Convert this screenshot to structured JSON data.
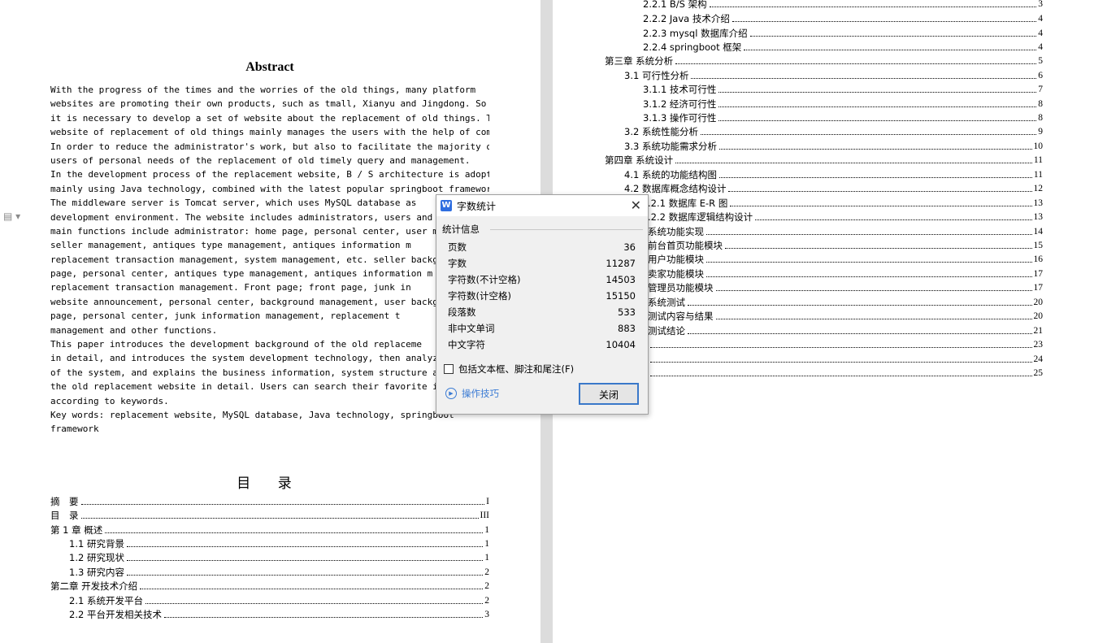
{
  "abstract": {
    "title": "Abstract",
    "lines": [
      "    With the progress of the times and the worries of the old things, many platform",
      "websites are promoting their own products, such as tmall, Xianyu and Jingdong. So",
      "it is necessary to develop a set of website about the replacement of old things. The",
      "website of replacement of old things mainly manages the users with the help of computer.",
      "In order to reduce the administrator's work, but also to facilitate the majority of",
      "users of personal needs of the replacement of old timely query and management.",
      "In the development process of the replacement website, B / S architecture is adopted,",
      "mainly using Java technology, combined with the latest popular springboot framework.",
      "The middleware server is Tomcat server, which uses MySQL database as",
      "development environment. The website includes administrators, users and se",
      "main functions include administrator: home page, personal center, user m",
      "seller management, antiques type management, antiques information m",
      "replacement transaction management, system management, etc. seller backgr",
      "page, personal center, antiques type management, antiques information m",
      "replacement transaction management. Front page; front page, junk in",
      "website announcement, personal center, background management, user backgro",
      "page, personal center, junk information management, replacement t",
      "management and other functions.",
      "    This paper introduces the development background of the old replaceme",
      "in detail, and introduces the system development technology, then analyzes",
      "of the system, and explains the business information, system structure a",
      "the old replacement website in detail. Users can search their favorite i",
      "according to keywords.",
      "    Key words: replacement website, MySQL database, Java technology, springboot",
      "framework"
    ]
  },
  "toc_left": {
    "title": "目 录",
    "items": [
      {
        "text": "摘　要",
        "page": "I"
      },
      {
        "text": "目　录",
        "page": "III"
      },
      {
        "text": "第 1 章  概述",
        "page": "1"
      },
      {
        "text": "1.1  研究背景",
        "page": "1"
      },
      {
        "text": "1.2  研究现状",
        "page": "1"
      },
      {
        "text": "1.3  研究内容",
        "page": "2"
      },
      {
        "text": "第二章  开发技术介绍",
        "page": "2"
      },
      {
        "text": "2.1    系统开发平台",
        "page": "2"
      },
      {
        "text": "2.2  平台开发相关技术",
        "page": "3"
      }
    ]
  },
  "toc_right": {
    "items": [
      {
        "text": "2.2.1    B/S 架构",
        "page": "3"
      },
      {
        "text": "2.2.2    Java 技术介绍",
        "page": "4"
      },
      {
        "text": "2.2.3    mysql 数据库介绍",
        "page": "4"
      },
      {
        "text": "2.2.4    springboot 框架",
        "page": "4"
      },
      {
        "text": "第三章  系统分析",
        "page": "5"
      },
      {
        "text": "3.1  可行性分析",
        "page": "6"
      },
      {
        "text": "3.1.1    技术可行性",
        "page": "7"
      },
      {
        "text": "3.1.2  经济可行性",
        "page": "8"
      },
      {
        "text": "3.1.3  操作可行性",
        "page": "8"
      },
      {
        "text": "3.2  系统性能分析",
        "page": "9"
      },
      {
        "text": "3.3  系统功能需求分析",
        "page": "10"
      },
      {
        "text": "第四章  系统设计",
        "page": "11"
      },
      {
        "text": "4.1  系统的功能结构图",
        "page": "11"
      },
      {
        "text": "4.2  数据库概念结构设计",
        "page": "12"
      },
      {
        "text": ".2.1    数据库 E-R 图",
        "page": "13"
      },
      {
        "text": ".2.2  数据库逻辑结构设计",
        "page": "13"
      },
      {
        "text": "系统功能实现",
        "page": "14"
      },
      {
        "text": "前台首页功能模块",
        "page": "15"
      },
      {
        "text": "用户功能模块",
        "page": "16"
      },
      {
        "text": "卖家功能模块",
        "page": "17"
      },
      {
        "text": "管理员功能模块",
        "page": "17"
      },
      {
        "text": "系统测试",
        "page": "20"
      },
      {
        "text": "测试内容与结果",
        "page": "20"
      },
      {
        "text": "测试结论",
        "page": "21"
      },
      {
        "text": "",
        "page": "23"
      },
      {
        "text": "",
        "page": "24"
      },
      {
        "text": "",
        "page": "25"
      }
    ]
  },
  "dialog": {
    "title": "字数统计",
    "logo": "W",
    "group_label": "统计信息",
    "stats": [
      {
        "label": "页数",
        "value": "36"
      },
      {
        "label": "字数",
        "value": "11287"
      },
      {
        "label": "字符数(不计空格)",
        "value": "14503"
      },
      {
        "label": "字符数(计空格)",
        "value": "15150"
      },
      {
        "label": "段落数",
        "value": "533"
      },
      {
        "label": "非中文单词",
        "value": "883"
      },
      {
        "label": "中文字符",
        "value": "10404"
      }
    ],
    "checkbox_label": "包括文本框、脚注和尾注(F)",
    "tips_label": "操作技巧",
    "close_button": "关闭",
    "close_glyph": "✕"
  },
  "doc_marker": "▤ ▾"
}
